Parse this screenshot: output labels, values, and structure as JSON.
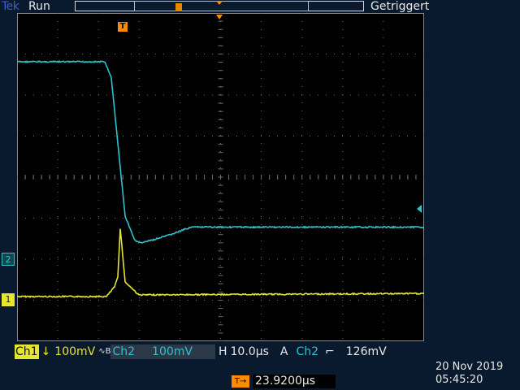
{
  "header": {
    "brand": "Tek",
    "acquisition_state": "Run",
    "trigger_status": "Getriggert"
  },
  "markers": {
    "trigger_marker_label": "T",
    "ch1_marker_label": "1",
    "ch2_marker_label": "2"
  },
  "readout": {
    "ch1_label": "Ch1",
    "ch1_coupling_symbol": "↓",
    "ch1_scale": "100mV",
    "bw_symbol": "∿B",
    "ch2_label": "Ch2",
    "ch2_scale": "100mV",
    "horizontal_label": "H",
    "horizontal_scale": "10.0µs",
    "trigger_mode": "A",
    "trigger_source": "Ch2",
    "trigger_slope_symbol": "⌐",
    "trigger_level": "126mV"
  },
  "trigger_position": {
    "icon": "T→",
    "value": "23.9200µs"
  },
  "clock": {
    "date": "20 Nov 2019",
    "time": "05:45:20"
  },
  "colors": {
    "ch1": "#e6e630",
    "ch2": "#2cc4cf",
    "trigger": "#ff8c00",
    "screen_bg": "#000000",
    "frame_bg": "#0a1a2e"
  }
}
